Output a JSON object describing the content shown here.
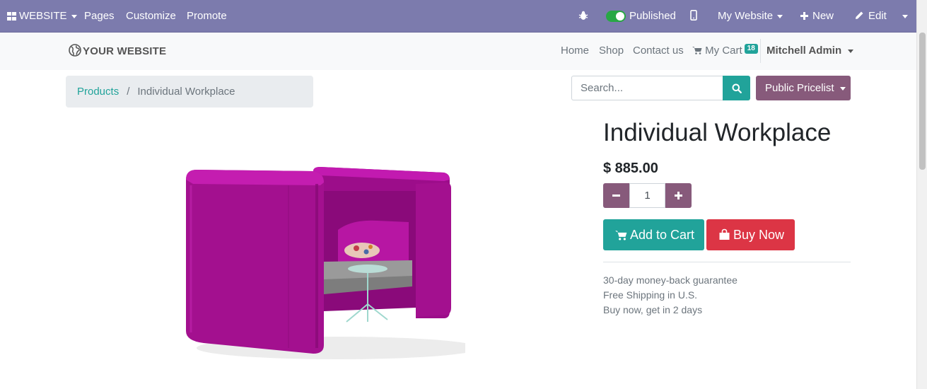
{
  "admin_bar": {
    "website_menu": "WEBSITE",
    "pages": "Pages",
    "customize": "Customize",
    "promote": "Promote",
    "published": "Published",
    "my_website": "My Website",
    "new": "New",
    "edit": "Edit",
    "bg_color": "#7c7bad"
  },
  "header": {
    "logo": "YOUR WEBSITE",
    "nav": [
      "Home",
      "Shop",
      "Contact us"
    ],
    "cart_label": "My Cart",
    "cart_count": "18",
    "user": "Mitchell Admin"
  },
  "breadcrumb": {
    "parent": "Products",
    "separator": "/",
    "current": "Individual Workplace"
  },
  "search": {
    "placeholder": "Search..."
  },
  "pricelist": {
    "label": "Public Pricelist"
  },
  "product": {
    "title": "Individual Workplace",
    "price": "$ 885.00",
    "quantity": "1",
    "add_to_cart": "Add to Cart",
    "buy_now": "Buy Now",
    "info": [
      "30-day money-back guarantee",
      "Free Shipping in U.S.",
      "Buy now, get in 2 days"
    ]
  },
  "colors": {
    "primary": "#875a7b",
    "accent": "#21a39a",
    "danger": "#dc3545"
  },
  "icons": [
    "apps-icon",
    "bug-icon",
    "mobile-icon",
    "plus-icon",
    "pencil-icon",
    "globe-icon",
    "cart-icon",
    "search-icon",
    "shopping-bag-icon"
  ]
}
